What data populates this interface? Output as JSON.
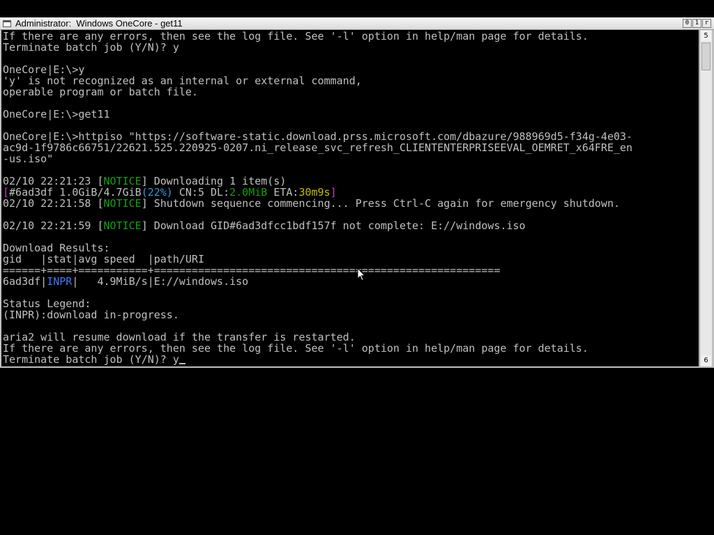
{
  "window": {
    "title": "Administrator:  Windows OneCore - get11",
    "buttons": [
      "0",
      "1",
      "r"
    ]
  },
  "scrollbar": {
    "up_glyph": "5",
    "down_glyph": "6"
  },
  "colors": {
    "console_text": "#c0c0c0",
    "notice": "#13a10e",
    "progress_bracket": "#c042c0",
    "progress_pct": "#3a96dd",
    "dl_speed": "#13a10e",
    "eta": "#c0c000",
    "inpr": "#3a78ff"
  },
  "console": {
    "lines": [
      [
        {
          "t": "If there are any errors, then see the log file. See '-l' option in help/man page for details."
        }
      ],
      [
        {
          "t": "Terminate batch job (Y/N)? y"
        }
      ],
      [
        {
          "t": ""
        }
      ],
      [
        {
          "t": "OneCore|E:\\>y"
        }
      ],
      [
        {
          "t": "'y' is not recognized as an internal or external command,"
        }
      ],
      [
        {
          "t": "operable program or batch file."
        }
      ],
      [
        {
          "t": ""
        }
      ],
      [
        {
          "t": "OneCore|E:\\>get11"
        }
      ],
      [
        {
          "t": ""
        }
      ],
      [
        {
          "t": "OneCore|E:\\>httpiso \"https://software-static.download.prss.microsoft.com/dbazure/988969d5-f34g-4e03-"
        }
      ],
      [
        {
          "t": "ac9d-1f9786c66751/22621.525.220925-0207.ni_release_svc_refresh_CLIENTENTERPRISEEVAL_OEMRET_x64FRE_en"
        }
      ],
      [
        {
          "t": "-us.iso\""
        }
      ],
      [
        {
          "t": ""
        }
      ],
      [
        {
          "t": "02/10 22:21:23 ["
        },
        {
          "t": "NOTICE",
          "c": "notice"
        },
        {
          "t": "] Downloading 1 item(s)"
        }
      ],
      [
        {
          "t": "[",
          "c": "progress_bracket"
        },
        {
          "t": "#6ad3df 1.0GiB/4.7GiB"
        },
        {
          "t": "(22%)",
          "c": "progress_pct"
        },
        {
          "t": " CN:5 DL:"
        },
        {
          "t": "2.0MiB",
          "c": "dl_speed"
        },
        {
          "t": " ETA:"
        },
        {
          "t": "30m9s",
          "c": "eta"
        },
        {
          "t": "]",
          "c": "progress_bracket"
        }
      ],
      [
        {
          "t": "02/10 22:21:58 ["
        },
        {
          "t": "NOTICE",
          "c": "notice"
        },
        {
          "t": "] Shutdown sequence commencing... Press Ctrl-C again for emergency shutdown."
        }
      ],
      [
        {
          "t": ""
        }
      ],
      [
        {
          "t": "02/10 22:21:59 ["
        },
        {
          "t": "NOTICE",
          "c": "notice"
        },
        {
          "t": "] Download GID#6ad3dfcc1bdf157f not complete: E://windows.iso"
        }
      ],
      [
        {
          "t": ""
        }
      ],
      [
        {
          "t": "Download Results:"
        }
      ],
      [
        {
          "t": "gid   |stat|avg speed  |path/URI"
        }
      ],
      [
        {
          "t": "======+====+===========+======================================================="
        }
      ],
      [
        {
          "t": "6ad3df|"
        },
        {
          "t": "INPR",
          "c": "inpr"
        },
        {
          "t": "|   4.9MiB/s|E://windows.iso"
        }
      ],
      [
        {
          "t": ""
        }
      ],
      [
        {
          "t": "Status Legend:"
        }
      ],
      [
        {
          "t": "(INPR):download in-progress."
        }
      ],
      [
        {
          "t": ""
        }
      ],
      [
        {
          "t": "aria2 will resume download if the transfer is restarted."
        }
      ],
      [
        {
          "t": "If there are any errors, then see the log file. See '-l' option in help/man page for details."
        }
      ],
      [
        {
          "t": "Terminate batch job (Y/N)? y"
        }
      ]
    ]
  }
}
